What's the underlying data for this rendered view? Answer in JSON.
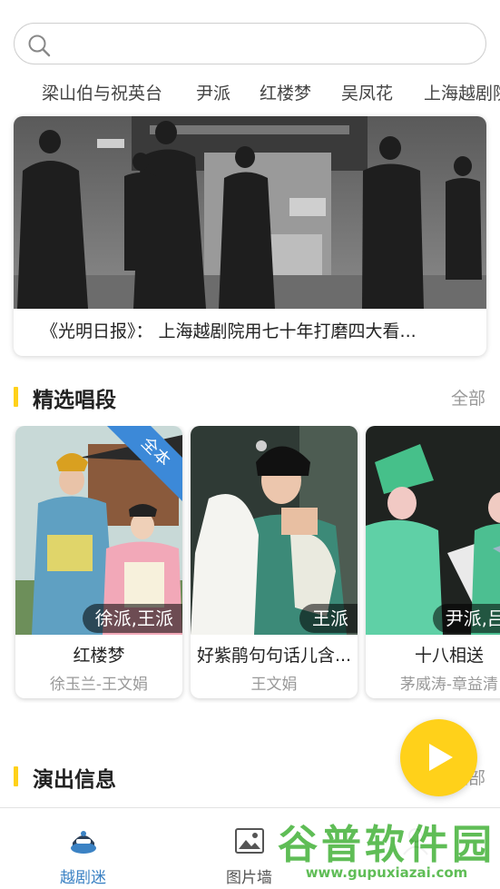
{
  "status": {
    "left": "",
    "right": ""
  },
  "search": {
    "placeholder": ""
  },
  "category_tabs": [
    "梁山伯与祝英台",
    "尹派",
    "红楼梦",
    "吴凤花",
    "上海越剧院"
  ],
  "banner": {
    "caption": "《光明日报》： 上海越剧院用七十年打磨四大看..."
  },
  "sections": {
    "featured": {
      "title": "精选唱段",
      "more": "全部"
    },
    "shows": {
      "title": "演出信息",
      "more": "全部"
    }
  },
  "cards": [
    {
      "name": "红楼梦",
      "artist": "徐玉兰-王文娟",
      "tag": "徐派,王派",
      "ribbon": "全本"
    },
    {
      "name": "好紫鹃句句话儿含...",
      "artist": "王文娟",
      "tag": "王派",
      "ribbon": ""
    },
    {
      "name": "十八相送",
      "artist": "茅威涛-章益清",
      "tag": "尹派,吕派",
      "ribbon": ""
    }
  ],
  "bottom_nav": [
    {
      "label": "越剧迷",
      "active": true,
      "icon": "mask-icon"
    },
    {
      "label": "图片墙",
      "active": false,
      "icon": "image-icon"
    },
    {
      "label": "",
      "active": false,
      "icon": "user-icon"
    }
  ],
  "watermark": {
    "text": "谷普软件园",
    "url": "www.gupuxiazai.com"
  },
  "colors": {
    "accent": "#ffd11a",
    "nav_active": "#3b82c4",
    "ribbon": "#3c89d8"
  }
}
